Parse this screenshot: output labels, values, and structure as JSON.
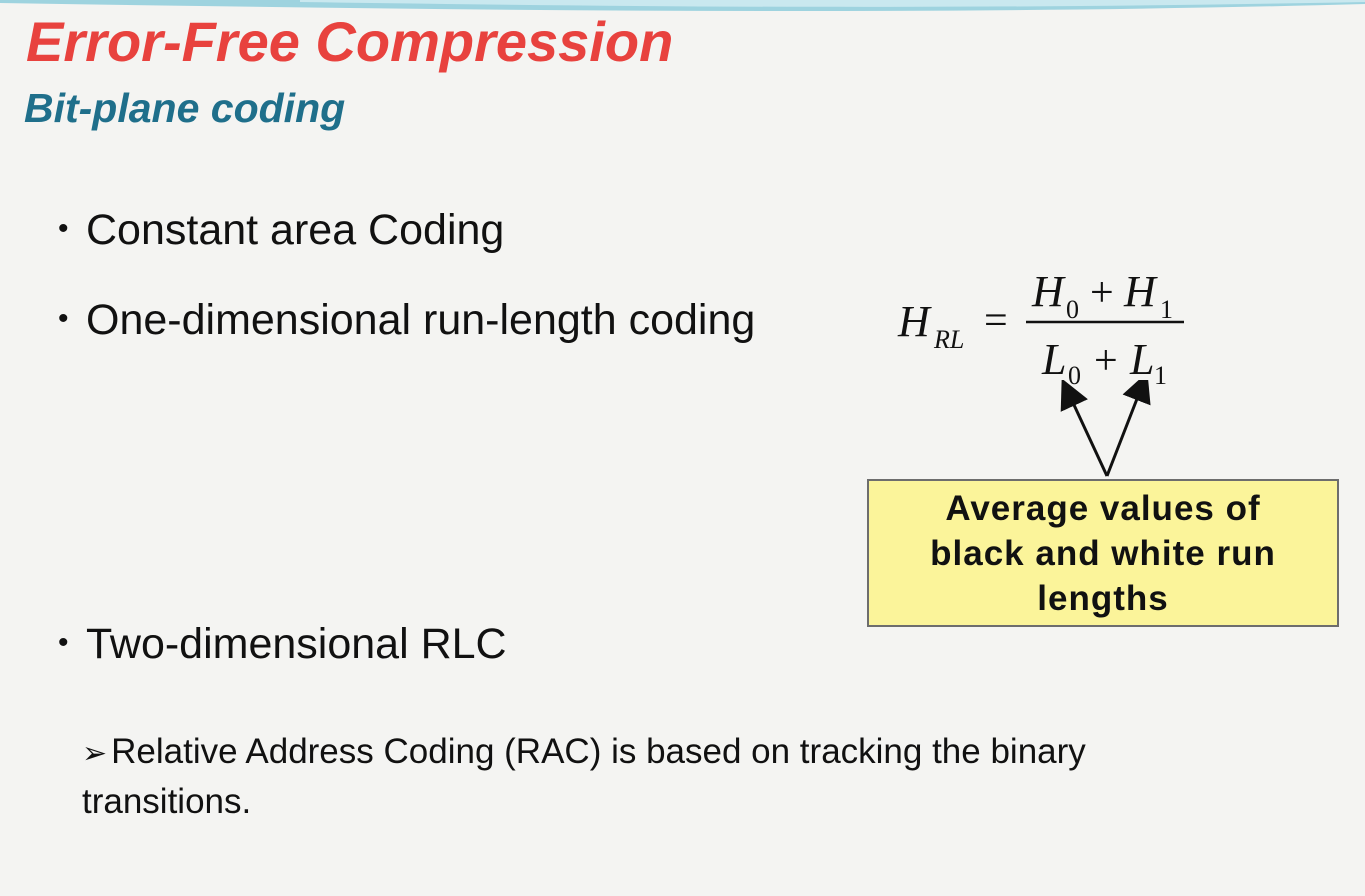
{
  "slide": {
    "title": "Error-Free Compression",
    "subtitle": "Bit-plane coding",
    "bullets": [
      "Constant area Coding",
      "One-dimensional run-length coding",
      "Two-dimensional RLC"
    ],
    "bullet_marker": "•",
    "sub_bullet": {
      "marker": "➢",
      "text": "Relative Address Coding (RAC) is based on tracking the binary transitions."
    },
    "formula": {
      "lhs": "H",
      "lhs_sub": "RL",
      "equals": "=",
      "num_a": "H",
      "num_a_sub": "0",
      "num_b": "H",
      "num_b_sub": "1",
      "den_a": "L",
      "den_a_sub": "0",
      "den_b": "L",
      "den_b_sub": "1",
      "plus": "+"
    },
    "callout": "Average values of black and white run lengths",
    "colors": {
      "title": "#e8423e",
      "subtitle": "#1f6f8b",
      "callout_fill": "#fbf49a",
      "background": "#f4f4f2"
    }
  }
}
